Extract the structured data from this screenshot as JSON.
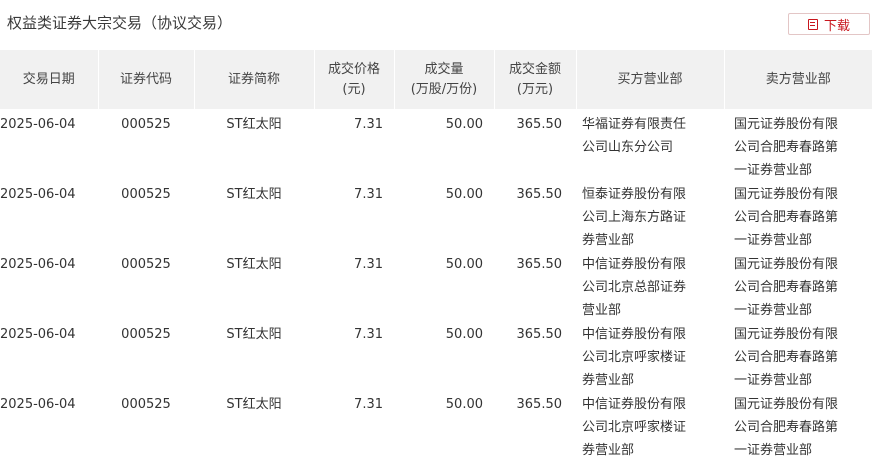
{
  "page": {
    "title": "权益类证券大宗交易（协议交易）"
  },
  "toolbar": {
    "download_label": "下载"
  },
  "table": {
    "headers": [
      [
        "交易日期"
      ],
      [
        "证券代码"
      ],
      [
        "证券简称"
      ],
      [
        "成交价格",
        "(元)"
      ],
      [
        "成交量",
        "(万股/万份)"
      ],
      [
        "成交金额",
        "(万元)"
      ],
      [
        "买方营业部"
      ],
      [
        "卖方营业部"
      ]
    ],
    "rows": [
      {
        "date": "2025-06-04",
        "code": "000525",
        "name": "ST红太阳",
        "price": "7.31",
        "volume": "50.00",
        "amount": "365.50",
        "buyer": "华福证券有限责任公司山东分公司",
        "seller": "国元证券股份有限公司合肥寿春路第一证券营业部"
      },
      {
        "date": "2025-06-04",
        "code": "000525",
        "name": "ST红太阳",
        "price": "7.31",
        "volume": "50.00",
        "amount": "365.50",
        "buyer": "恒泰证券股份有限公司上海东方路证券营业部",
        "seller": "国元证券股份有限公司合肥寿春路第一证券营业部"
      },
      {
        "date": "2025-06-04",
        "code": "000525",
        "name": "ST红太阳",
        "price": "7.31",
        "volume": "50.00",
        "amount": "365.50",
        "buyer": "中信证券股份有限公司北京总部证券营业部",
        "seller": "国元证券股份有限公司合肥寿春路第一证券营业部"
      },
      {
        "date": "2025-06-04",
        "code": "000525",
        "name": "ST红太阳",
        "price": "7.31",
        "volume": "50.00",
        "amount": "365.50",
        "buyer": "中信证券股份有限公司北京呼家楼证券营业部",
        "seller": "国元证券股份有限公司合肥寿春路第一证券营业部"
      },
      {
        "date": "2025-06-04",
        "code": "000525",
        "name": "ST红太阳",
        "price": "7.31",
        "volume": "50.00",
        "amount": "365.50",
        "buyer": "中信证券股份有限公司北京呼家楼证券营业部",
        "seller": "国元证券股份有限公司合肥寿春路第一证券营业部"
      }
    ]
  },
  "colors": {
    "accent": "#c8161d",
    "header_bg": "#f1f1f1"
  },
  "icons": {
    "download": "document-icon"
  }
}
